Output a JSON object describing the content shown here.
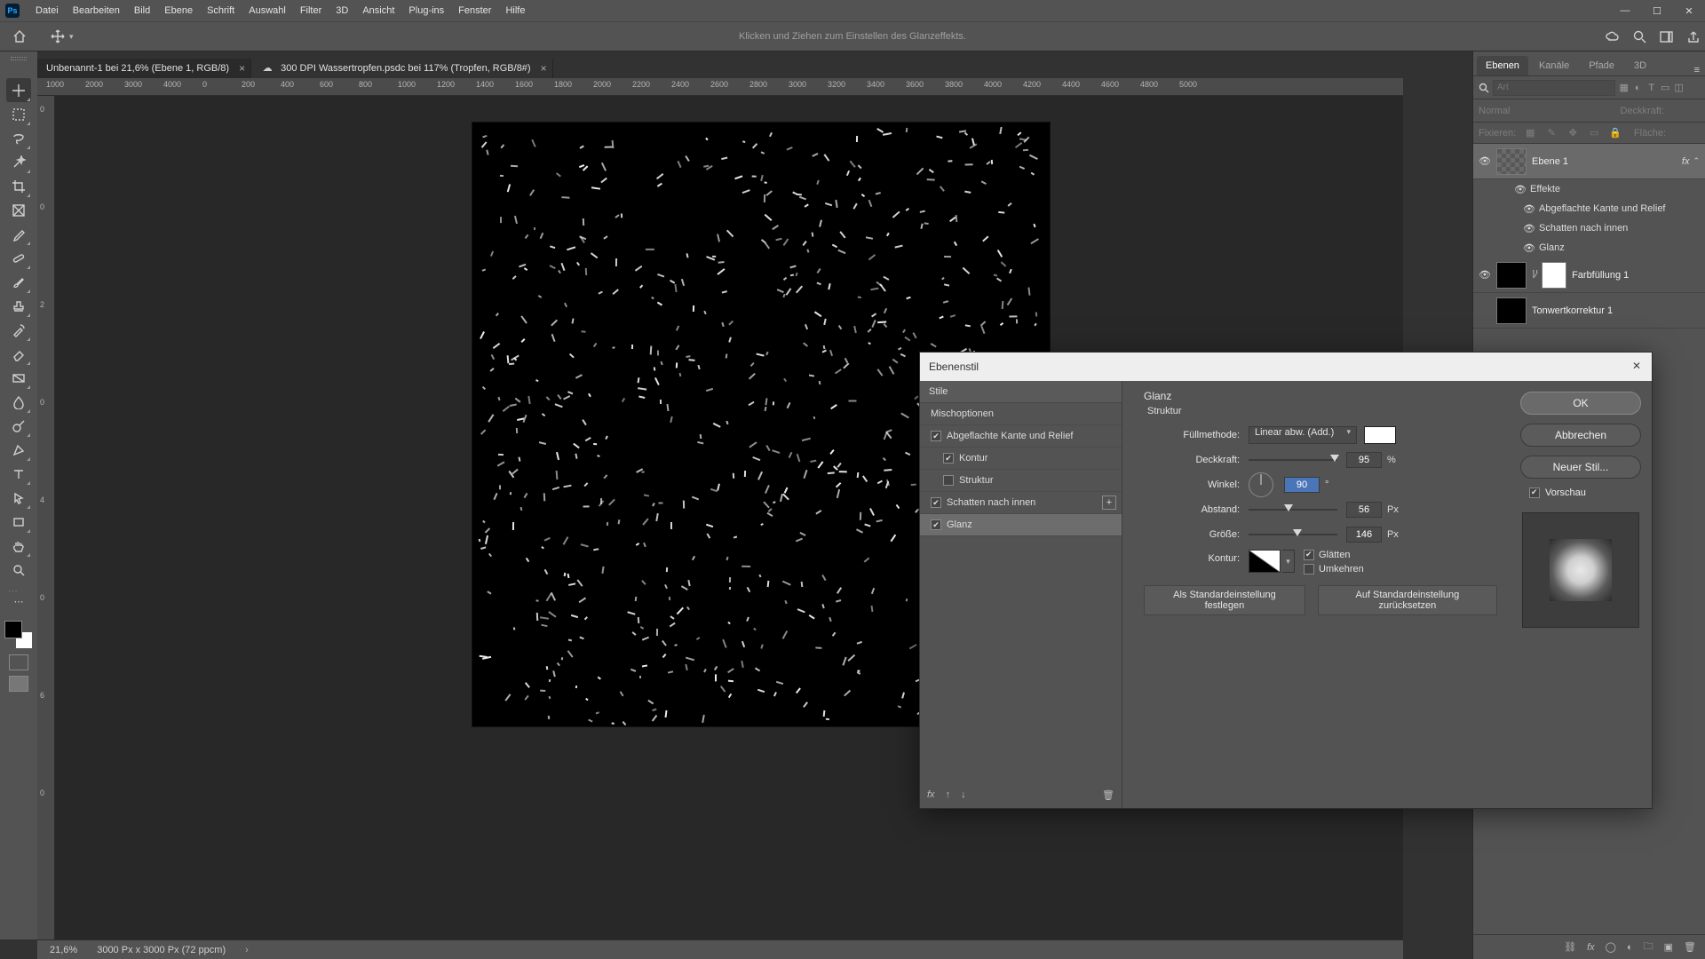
{
  "menu": {
    "items": [
      "Datei",
      "Bearbeiten",
      "Bild",
      "Ebene",
      "Schrift",
      "Auswahl",
      "Filter",
      "3D",
      "Ansicht",
      "Plug-ins",
      "Fenster",
      "Hilfe"
    ]
  },
  "optbar": {
    "hint": "Klicken und Ziehen zum Einstellen des Glanzeffekts."
  },
  "tabs": {
    "t0": {
      "label": "Unbenannt-1 bei 21,6% (Ebene 1, RGB/8)"
    },
    "t1": {
      "label": "300 DPI Wassertropfen.psdc bei 117% (Tropfen, RGB/8#)"
    }
  },
  "ruler_h": [
    "1000",
    "2000",
    "3000",
    "4000",
    "0",
    "200",
    "400",
    "600",
    "800",
    "1000",
    "1200",
    "1400",
    "1600",
    "1800",
    "2000",
    "2200",
    "2400",
    "2600",
    "2800",
    "3000",
    "3200",
    "3400",
    "3600",
    "3800",
    "4000",
    "4200",
    "4400",
    "4600",
    "4800",
    "5000"
  ],
  "ruler_v": [
    "0",
    "0",
    "2",
    "0",
    "4",
    "0",
    "6",
    "0"
  ],
  "status": {
    "zoom": "21,6%",
    "dims": "3000 Px x 3000 Px (72 ppcm)"
  },
  "panels": {
    "tabs": {
      "layers": "Ebenen",
      "channels": "Kanäle",
      "paths": "Pfade",
      "threeD": "3D"
    },
    "filter_placeholder": "Art",
    "blend": {
      "mode": "Normal",
      "opacity_label": "Deckkraft:",
      "fill_label": "Fläche:",
      "lock_label": "Fixieren:"
    },
    "layers": {
      "l1": "Ebene 1",
      "fx": "Effekte",
      "fx_bevel": "Abgeflachte Kante und Relief",
      "fx_inner": "Schatten nach innen",
      "fx_satin": "Glanz",
      "fill1": "Farbfüllung 1",
      "curves": "Tonwertkorrektur 1"
    }
  },
  "dialog": {
    "title": "Ebenenstil",
    "left": {
      "header": "Stile",
      "blend": "Mischoptionen",
      "bevel": "Abgeflachte Kante und Relief",
      "contour": "Kontur",
      "structure": "Struktur",
      "inner": "Schatten nach innen",
      "satin": "Glanz"
    },
    "params": {
      "title": "Glanz",
      "sub": "Struktur",
      "fill_label": "Füllmethode:",
      "fill_value": "Linear abw. (Add.)",
      "opacity_label": "Deckkraft:",
      "opacity_value": "95",
      "opacity_unit": "%",
      "angle_label": "Winkel:",
      "angle_value": "90",
      "angle_unit": "°",
      "distance_label": "Abstand:",
      "distance_value": "56",
      "distance_unit": "Px",
      "size_label": "Größe:",
      "size_value": "146",
      "size_unit": "Px",
      "contour_label": "Kontur:",
      "smooth": "Glätten",
      "invert": "Umkehren",
      "make_default": "Als Standardeinstellung festlegen",
      "reset_default": "Auf Standardeinstellung zurücksetzen"
    },
    "right": {
      "ok": "OK",
      "cancel": "Abbrechen",
      "new_style": "Neuer Stil...",
      "preview": "Vorschau"
    }
  }
}
